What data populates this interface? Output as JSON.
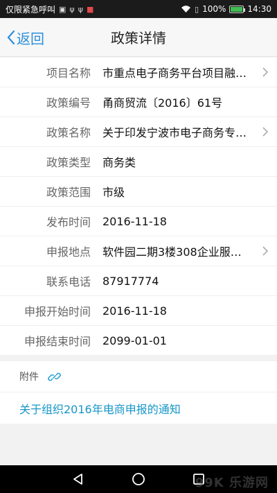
{
  "status_bar": {
    "left_text": "仅限紧急呼叫",
    "battery_percent": "100%",
    "battery_level": 1.0,
    "time": "14:30"
  },
  "nav": {
    "back_label": "返回",
    "title": "政策详情"
  },
  "details": [
    {
      "label": "项目名称",
      "value": "市重点电子商务平台项目融…",
      "has_chevron": true
    },
    {
      "label": "政策编号",
      "value": "甬商贸流〔2016〕61号",
      "has_chevron": false
    },
    {
      "label": "政策名称",
      "value": "关于印发宁波市电子商务专…",
      "has_chevron": true
    },
    {
      "label": "政策类型",
      "value": "商务类",
      "has_chevron": false
    },
    {
      "label": "政策范围",
      "value": "市级",
      "has_chevron": false
    },
    {
      "label": "发布时间",
      "value": "2016-11-18",
      "has_chevron": false
    },
    {
      "label": "申报地点",
      "value": "软件园二期3楼308企业服…",
      "has_chevron": true
    },
    {
      "label": "联系电话",
      "value": "87917774",
      "has_chevron": false
    },
    {
      "label": "申报开始时间",
      "value": "2016-11-18",
      "has_chevron": false
    },
    {
      "label": "申报结束时间",
      "value": "2099-01-01",
      "has_chevron": false
    }
  ],
  "attachments": {
    "label": "附件",
    "items": [
      "关于组织2016年电商申报的通知"
    ]
  },
  "colors": {
    "accent": "#2a8fdc",
    "link": "#1596c8"
  }
}
